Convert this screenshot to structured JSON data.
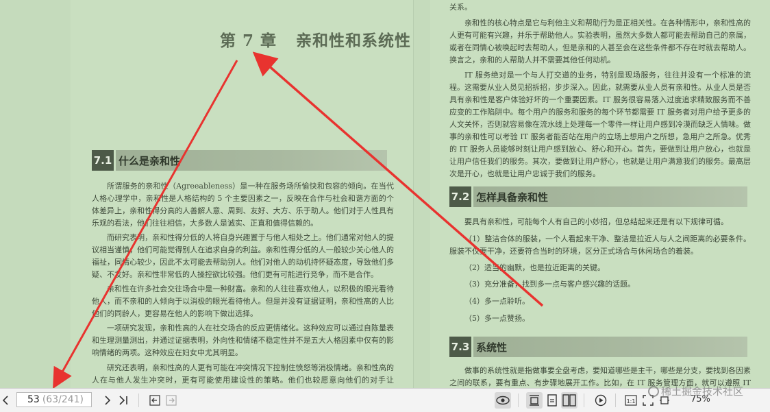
{
  "left_page": {
    "chapter": {
      "number": "第 7 章",
      "title": "亲和性和系统性"
    },
    "section_71": {
      "num": "7.1",
      "title": "什么是亲和性"
    },
    "paragraphs": [
      "所谓服务的亲和性（Agreeableness）是一种在服务场所愉快和包容的倾向。在当代人格心理学中，亲和性是人格结构的 5 个主要因素之一，反映在合作与社会和谐方面的个体差异上，亲和性得分高的人善解人意、周到、友好、大方、乐于助人。他们对于人性具有乐观的看法，他们往往相信，大多数人是诚实、正直和值得信赖的。",
      "而研究表明，亲和性得分低的人将自身兴趣置于与他人相处之上。他们通常对他人的提议相当谨慎，他们可能觉得别人在追求自身的利益。亲和性得分低的人一般较少关心他人的福祉，同情心较少，因此不太可能去帮助别人。他们对他人的动机持怀疑态度，导致他们多疑、不友好。亲和性非常低的人操控欲比较强。他们更有可能进行竞争，而不是合作。",
      "亲和性在许多社会交往场合中是一种财富。亲和的人往往喜欢他人，以积极的眼光看待他人，而不亲和的人倾向于以消极的眼光看待他人。但是并没有证据证明，亲和性高的人比他们的同龄人，更容易在他人的影响下做出选择。",
      "一项研究发现，亲和性高的人在社交场合的反应更情绪化。这种效应可以通过自陈量表和生理测量测出，并通过证据表明，外向性和情绪不稳定性并不是五大人格因素中仅有的影响情绪的两项。这种效应在妇女中尤其明显。",
      "研究还表明，亲和性高的人更有可能在冲突情况下控制住愤怒等消极情绪。亲和性高的人在与他人发生冲突时，更有可能使用建设性的策略。他们也较愿意向他们的对手让步，“输”"
    ]
  },
  "right_page": {
    "top_fragment": "关系。",
    "paragraphs_top": [
      "亲和性的核心特点是它与利他主义和帮助行为是正相关性。在各种情形中，亲和性高的人更有可能有兴趣，并乐于帮助他人。实验表明，虽然大多数人都可能去帮助自己的亲属，或者在同情心被唤起时去帮助人，但是亲和的人甚至会在这些条件都不存在时就去帮助人。换言之，亲和的人帮助人并不需要其他任何动机。",
      "IT 服务绝对是一个与人打交道的业务，特别是现场服务，往往并没有一个标准的流程。这需要从业人员见招拆招，步步深入。因此，就需要从业人员有亲和性。从业人员是否具有亲和性是客户体验好坏的一个重要因素。IT 服务很容易落入过度追求精致服务而不善应变的工作陷阱中。每个用户的服务和服务的每个环节都需要 IT 服务者对用户给予更多的人文关怀，否则就容易像在流水线上处理每一个零件一样让用户感到冷漠而缺乏人情味。做事的亲和性可以考验 IT 服务者能否站在用户的立场上想用户之所想，急用户之所急。优秀的 IT 服务人员能够时刻让用户感到放心、舒心和开心。首先，要做到让用户放心，也就是让用户信任我们的服务。其次，要做到让用户舒心，也就是让用户满意我们的服务。最高层次是开心，也就是让用户忠诚于我们的服务。"
    ],
    "section_72": {
      "num": "7.2",
      "title": "怎样具备亲和性"
    },
    "intro_72": "要具有亲和性，可能每个人有自己的小妙招，但总结起来还是有以下规律可循。",
    "list_items": [
      "（1）整洁合体的服装，一个人看起来干净、整洁是拉近人与人之间距离的必要条件。服装不仅要干净，还要符合当时的环境，区分正式场合与休闲场合的着装。",
      "（2）适当的幽默，也是拉近距离的关键。",
      "（3）充分准备，找到多一点与客户感兴趣的话题。",
      "（4）多一点聆听。",
      "（5）多一点赞扬。"
    ],
    "section_73": {
      "num": "7.3",
      "title": "系统性"
    },
    "para_73": "做事的系统性就是指做事要全盘考虑，要知道哪些是主干，哪些是分支，要找到各因素之间的联系，要有重点、有步骤地展开工作。比如，在 IT 服务管理方面，就可以遵照 IT 服务的"
  },
  "toolbar": {
    "prev_icon": "chevron-left-icon",
    "page_current": "53",
    "page_total": "(63/241)",
    "next_icon": "chevron-right-icon",
    "last_icon": "skip-last-icon",
    "zoom": "75%"
  },
  "watermark": "稀土掘金技术社区",
  "colors": {
    "annotation_arrow": "#e8332f",
    "page_bg": "#c9dfc0",
    "section_block": "#4d5a48"
  }
}
